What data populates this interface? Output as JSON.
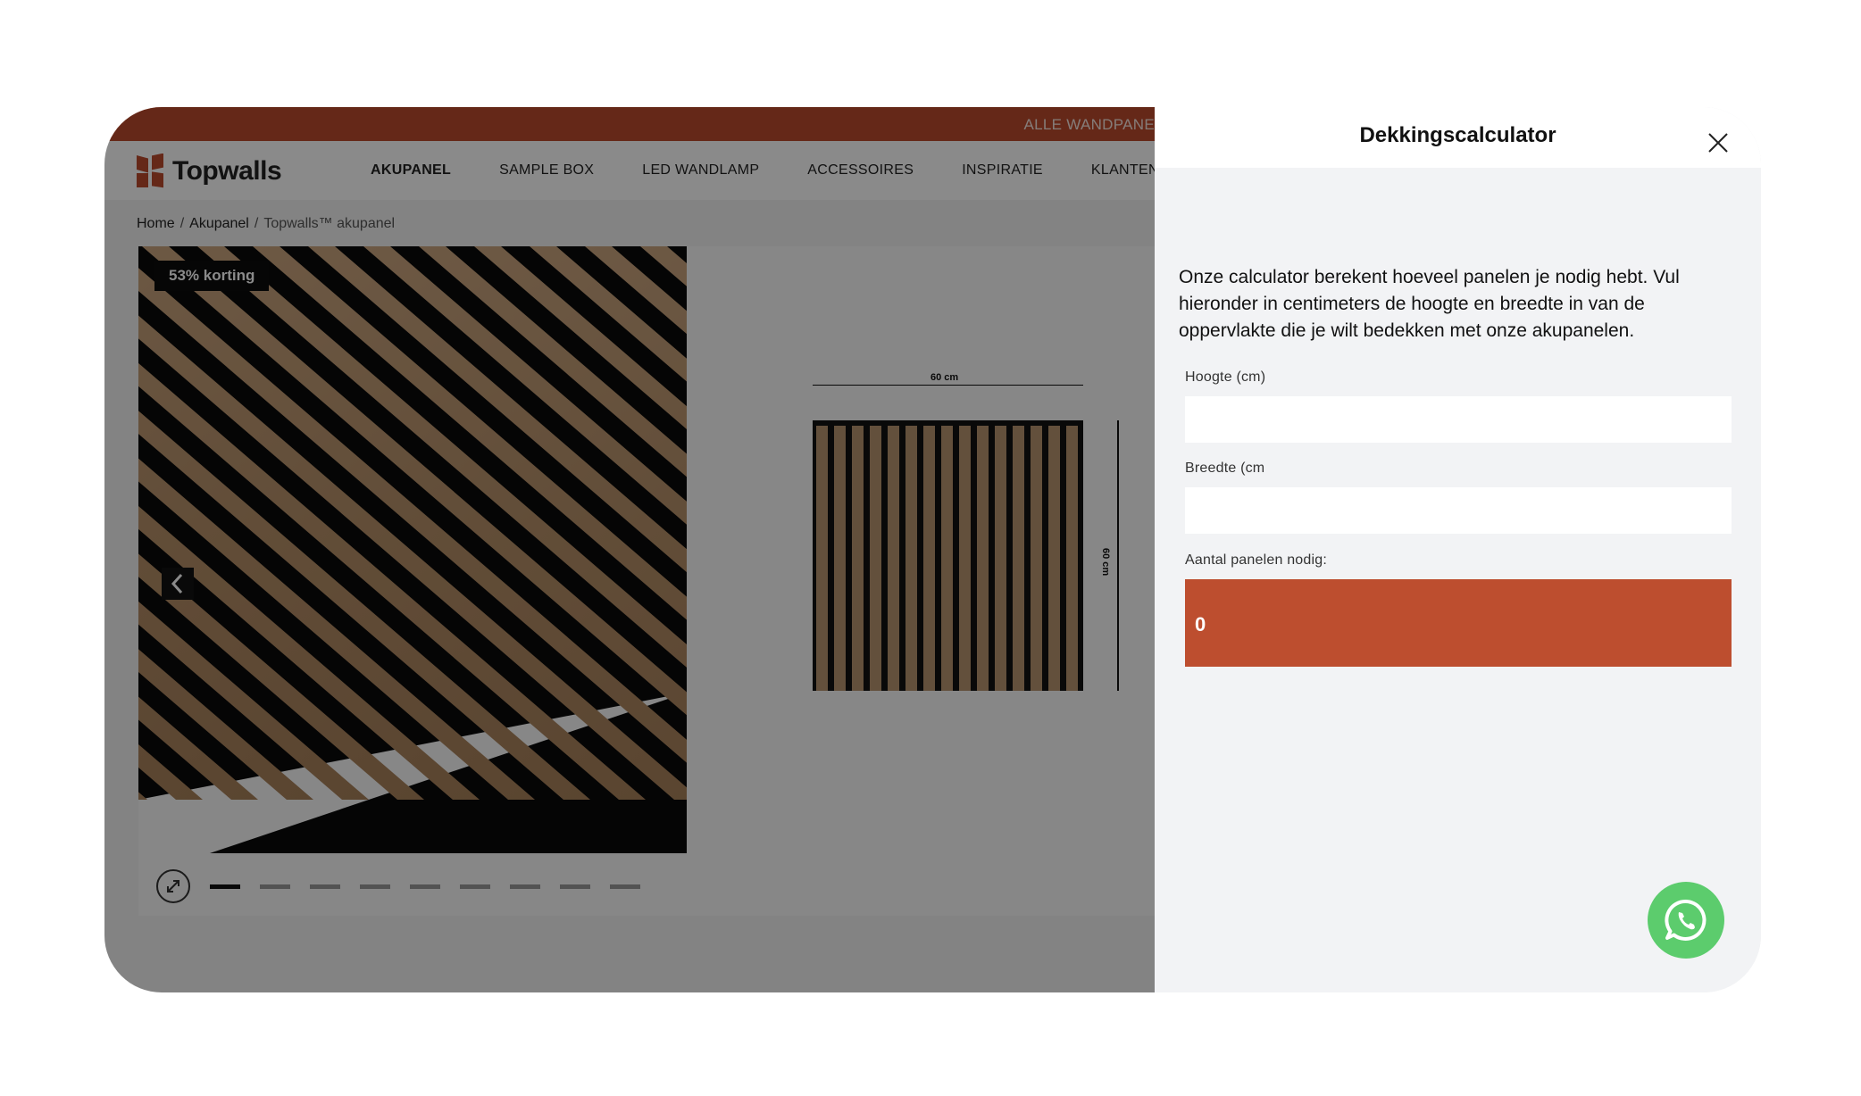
{
  "promo": {
    "text": "ALLE WANDPANE"
  },
  "brand": {
    "name": "Topwalls"
  },
  "nav": {
    "items": [
      "AKUPANEL",
      "SAMPLE BOX",
      "LED WANDLAMP",
      "ACCESSOIRES",
      "INSPIRATIE",
      "KLANTENSER"
    ]
  },
  "breadcrumb": {
    "home": "Home",
    "category": "Akupanel",
    "current": "Topwalls™ akupanel"
  },
  "gallery": {
    "badge": "53% korting",
    "dim_width": "60 cm",
    "dim_height": "60 cm",
    "dots_total": 9,
    "active_dot": 1
  },
  "drawer": {
    "title": "Dekkingscalculator",
    "intro": "Onze calculator berekent hoeveel panelen je nodig hebt. Vul hieronder in centimeters de hoogte en breedte in van de oppervlakte die je wilt bedekken met onze akupanelen.",
    "height_label": "Hoogte (cm)",
    "height_value": "",
    "width_label": "Breedte (cm",
    "width_value": "",
    "result_label": "Aantal panelen nodig:",
    "result_value": "0"
  },
  "colors": {
    "accent": "#bd4e2f",
    "whatsapp": "#5ccc6d",
    "promo_bar": "#bb4a2e"
  },
  "icons": [
    "close-icon",
    "chevron-left-icon",
    "zoom-expand-icon",
    "whatsapp-icon",
    "topwalls-logo-icon"
  ]
}
